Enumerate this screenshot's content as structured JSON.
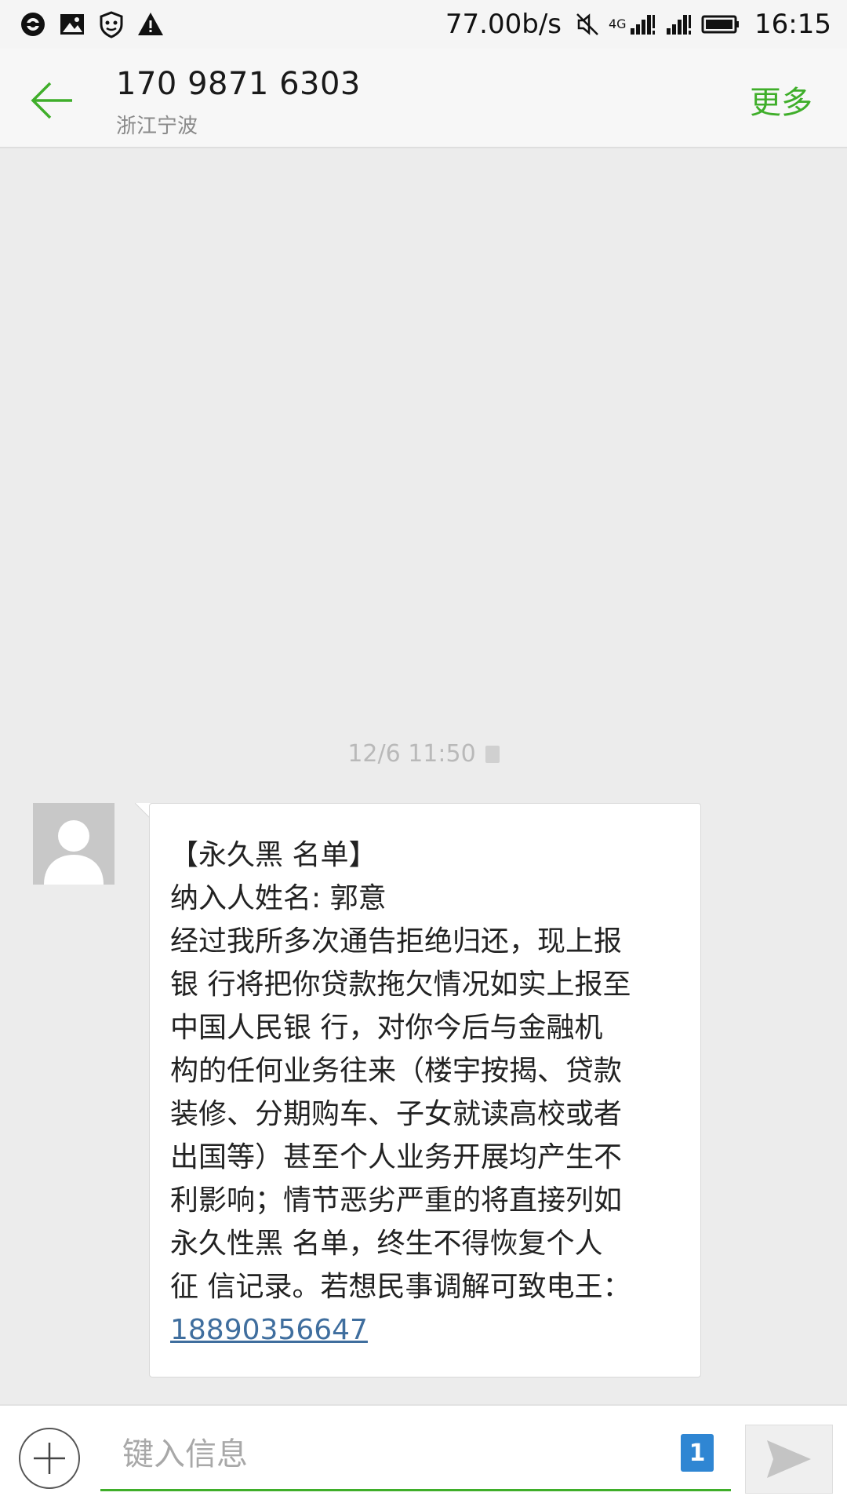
{
  "status_bar": {
    "icons_left": [
      "vpn-key-icon",
      "image-icon",
      "shield-icon",
      "warning-icon"
    ],
    "net_speed": "77.00b/s",
    "network_type": "4G",
    "icons_right": [
      "mute-icon",
      "signal-4g-icon",
      "signal-icon",
      "battery-icon"
    ],
    "time": "16:15"
  },
  "header": {
    "contact_number": "170 9871 6303",
    "contact_location": "浙江宁波",
    "more_label": "更多",
    "accent_color": "#3fae2a"
  },
  "conversation": {
    "timestamp": "12/6 11:50",
    "message": {
      "lines": [
        "【永久黑 名单】",
        "纳入人姓名: 郭意",
        "经过我所多次通告拒绝归还，现上报",
        "银 行将把你贷款拖欠情况如实上报至",
        "中国人民银 行，对你今后与金融机",
        "构的任何业务往来（楼宇按揭、贷款",
        "装修、分期购车、子女就读高校或者",
        "出国等）甚至个人业务开展均产生不",
        "利影响；情节恶劣严重的将直接列如",
        "永久性黑 名单，终生不得恢复个人",
        "征 信记录。若想民事调解可致电王："
      ],
      "phone_link": "18890356647"
    }
  },
  "input_bar": {
    "placeholder": "键入信息",
    "sim_slot": "1"
  }
}
